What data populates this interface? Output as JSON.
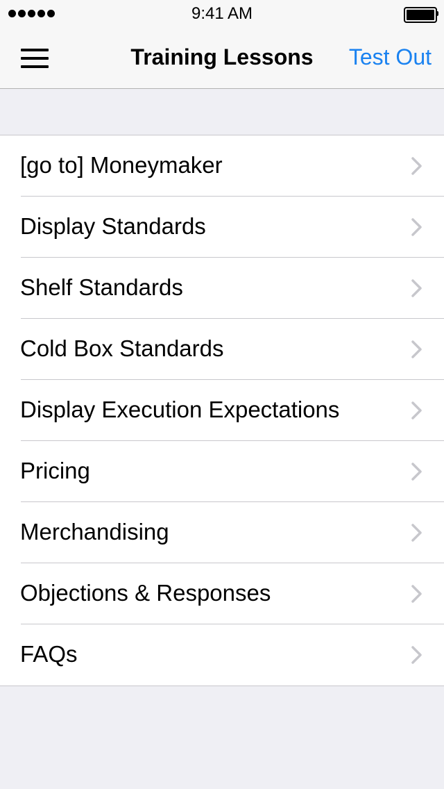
{
  "status_bar": {
    "time": "9:41 AM"
  },
  "nav_bar": {
    "title": "Training Lessons",
    "right_button": "Test Out",
    "menu_icon": "hamburger-menu-icon"
  },
  "colors": {
    "accent": "#1a82f0",
    "background": "#efeff4",
    "separator": "#c8c7cc",
    "chevron": "#c7c7cc"
  },
  "lessons": [
    {
      "label": "[go to] Moneymaker"
    },
    {
      "label": "Display Standards"
    },
    {
      "label": "Shelf Standards"
    },
    {
      "label": "Cold Box Standards"
    },
    {
      "label": "Display Execution Expectations"
    },
    {
      "label": "Pricing"
    },
    {
      "label": "Merchandising"
    },
    {
      "label": "Objections & Responses"
    },
    {
      "label": "FAQs"
    }
  ]
}
